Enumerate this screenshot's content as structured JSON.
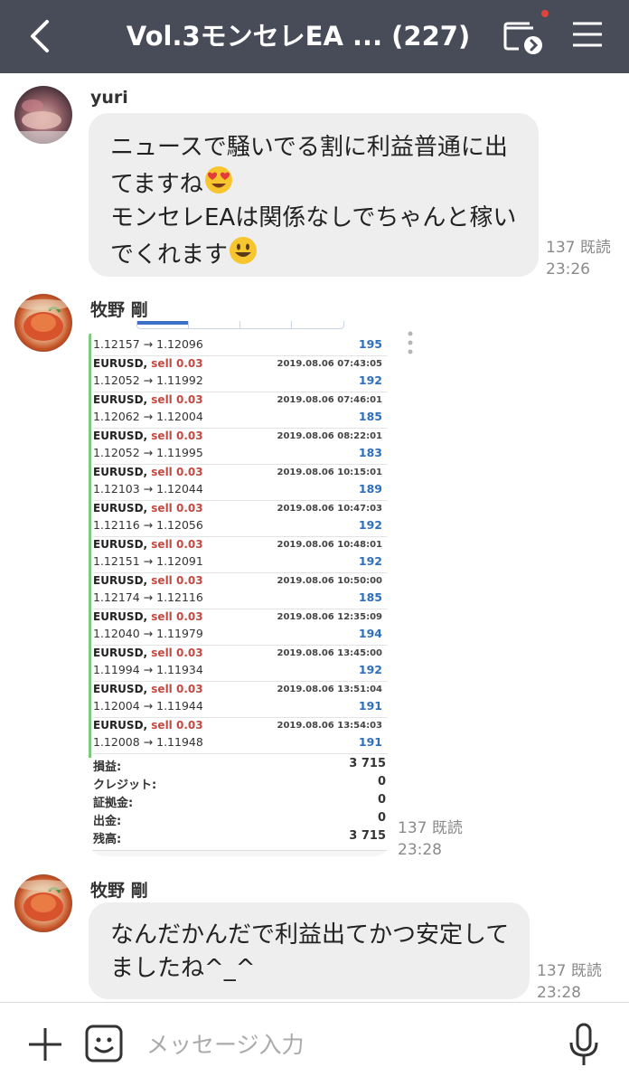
{
  "header": {
    "title": "Vol.3モンセレEA ... (227)",
    "notification_color": "#e0453d",
    "icons": [
      "back-icon",
      "cast-icon",
      "menu-icon"
    ]
  },
  "messages": [
    {
      "sender": "yuri",
      "lines": [
        "ニュースで騒いでる割に利益普通に出",
        "てますね",
        "モンセレEAは関係なしでちゃんと稼い",
        "でくれます"
      ],
      "emoji": [
        "heart-eyes-emoji",
        "smiley-emoji"
      ],
      "read": "137 既読",
      "time": "23:26"
    },
    {
      "sender": "牧野 剛",
      "type": "image",
      "read": "137 既読",
      "time": "23:28"
    },
    {
      "sender": "牧野 剛",
      "lines": [
        "なんだかんだで利益出てかつ安定して",
        "ましたね^_^"
      ],
      "read": "137 既読",
      "time": "23:28"
    }
  ],
  "trades": {
    "first_prices": "1.12157 → 1.12096",
    "first_points": "195",
    "rows": [
      {
        "symbol": "EURUSD,",
        "action": "sell 0.03",
        "datetime": "2019.08.06 07:43:05",
        "prices": "1.12052 → 1.11992",
        "points": "192"
      },
      {
        "symbol": "EURUSD,",
        "action": "sell 0.03",
        "datetime": "2019.08.06 07:46:01",
        "prices": "1.12062 → 1.12004",
        "points": "185"
      },
      {
        "symbol": "EURUSD,",
        "action": "sell 0.03",
        "datetime": "2019.08.06 08:22:01",
        "prices": "1.12052 → 1.11995",
        "points": "183"
      },
      {
        "symbol": "EURUSD,",
        "action": "sell 0.03",
        "datetime": "2019.08.06 10:15:01",
        "prices": "1.12103 → 1.12044",
        "points": "189"
      },
      {
        "symbol": "EURUSD,",
        "action": "sell 0.03",
        "datetime": "2019.08.06 10:47:03",
        "prices": "1.12116 → 1.12056",
        "points": "192"
      },
      {
        "symbol": "EURUSD,",
        "action": "sell 0.03",
        "datetime": "2019.08.06 10:48:01",
        "prices": "1.12151 → 1.12091",
        "points": "192"
      },
      {
        "symbol": "EURUSD,",
        "action": "sell 0.03",
        "datetime": "2019.08.06 10:50:00",
        "prices": "1.12174 → 1.12116",
        "points": "185"
      },
      {
        "symbol": "EURUSD,",
        "action": "sell 0.03",
        "datetime": "2019.08.06 12:35:09",
        "prices": "1.12040 → 1.11979",
        "points": "194"
      },
      {
        "symbol": "EURUSD,",
        "action": "sell 0.03",
        "datetime": "2019.08.06 13:45:00",
        "prices": "1.11994 → 1.11934",
        "points": "192"
      },
      {
        "symbol": "EURUSD,",
        "action": "sell 0.03",
        "datetime": "2019.08.06 13:51:04",
        "prices": "1.12004 → 1.11944",
        "points": "191"
      },
      {
        "symbol": "EURUSD,",
        "action": "sell 0.03",
        "datetime": "2019.08.06 13:54:03",
        "prices": "1.12008 → 1.11948",
        "points": "191"
      }
    ],
    "summary": [
      {
        "label": "損益:",
        "value": "3 715"
      },
      {
        "label": "クレジット:",
        "value": "0"
      },
      {
        "label": "証拠金:",
        "value": "0"
      },
      {
        "label": "出金:",
        "value": "0"
      },
      {
        "label": "残高:",
        "value": "3 715"
      }
    ],
    "colors": {
      "sell": "#c8473f",
      "points": "#2e6fbd",
      "bar": "#7fc97f"
    }
  },
  "input": {
    "placeholder": "メッセージ入力",
    "icons": [
      "plus-icon",
      "sticker-icon",
      "mic-icon"
    ]
  }
}
